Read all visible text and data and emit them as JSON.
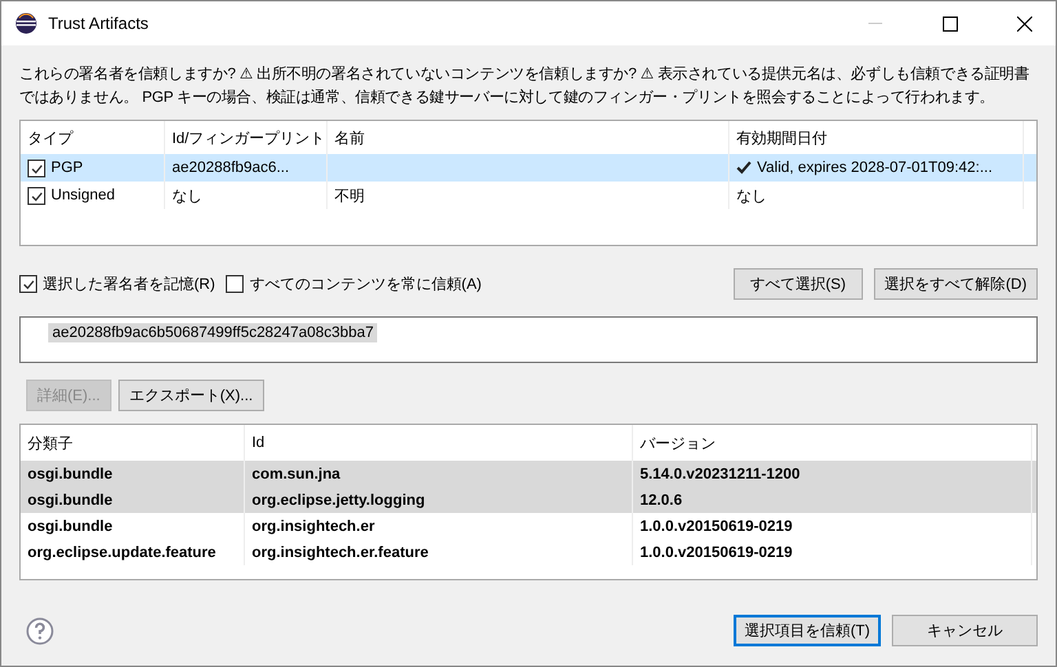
{
  "window": {
    "title": "Trust Artifacts"
  },
  "description": "これらの署名者を信頼しますか? ⚠ 出所不明の署名されていないコンテンツを信頼しますか? ⚠ 表示されている提供元名は、必ずしも信頼できる証明書ではありません。 PGP キーの場合、検証は通常、信頼できる鍵サーバーに対して鍵のフィンガー・プリントを照会することによって行われます。",
  "signers": {
    "columns": [
      "タイプ",
      "Id/フィンガープリント",
      "名前",
      "有効期間日付"
    ],
    "rows": [
      {
        "checked": true,
        "selected": true,
        "type": "PGP",
        "id": "ae20288fb9ac6...",
        "name": "",
        "expiry": "Valid, expires 2028-07-01T09:42:...",
        "verified": true
      },
      {
        "checked": true,
        "selected": false,
        "type": "Unsigned",
        "id": "なし",
        "name": "不明",
        "expiry": "なし",
        "verified": false
      }
    ]
  },
  "options": [
    {
      "label": "選択した署名者を記憶(R)",
      "checked": true
    },
    {
      "label": "すべてのコンテンツを常に信頼(A)",
      "checked": false
    }
  ],
  "selection_buttons": [
    "すべて選択(S)",
    "選択をすべて解除(D)"
  ],
  "fingerprint": {
    "text": "ae20288fb9ac6b50687499ff5c28247a08c3bba7",
    "highlighted": true
  },
  "action_buttons": [
    {
      "label": "詳細(E)...",
      "disabled": true
    },
    {
      "label": "エクスポート(X)...",
      "disabled": false
    }
  ],
  "artifacts": {
    "columns": [
      "分類子",
      "Id",
      "バージョン"
    ],
    "rows": [
      {
        "selected": true,
        "classifier": "osgi.bundle",
        "id": "com.sun.jna",
        "version": "5.14.0.v20231211-1200"
      },
      {
        "selected": true,
        "classifier": "osgi.bundle",
        "id": "org.eclipse.jetty.logging",
        "version": "12.0.6"
      },
      {
        "selected": false,
        "classifier": "osgi.bundle",
        "id": "org.insightech.er",
        "version": "1.0.0.v20150619-0219"
      },
      {
        "selected": false,
        "classifier": "org.eclipse.update.feature",
        "id": "org.insightech.er.feature",
        "version": "1.0.0.v20150619-0219"
      }
    ]
  },
  "footer_buttons": [
    {
      "label": "選択項目を信頼(T)",
      "default": true
    },
    {
      "label": "キャンセル",
      "default": false
    }
  ]
}
